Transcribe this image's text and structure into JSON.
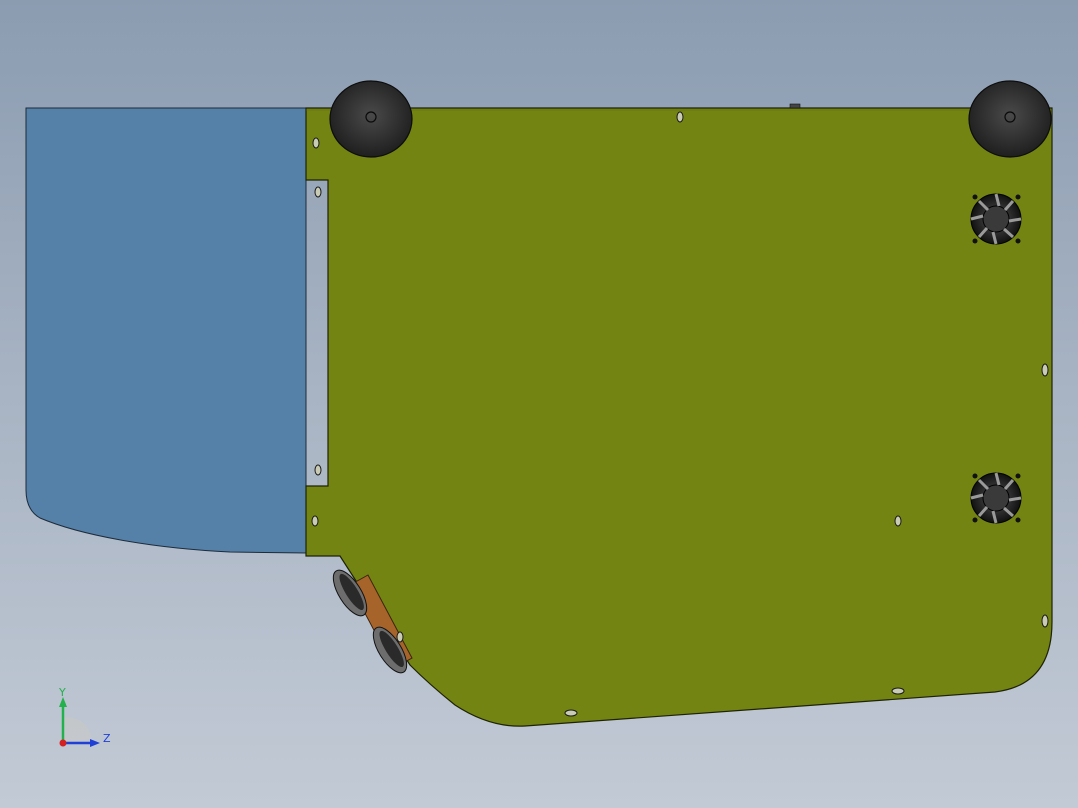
{
  "viewport": {
    "background_top": "#8b9cb1",
    "background_bottom": "#c2cad5"
  },
  "model": {
    "main_panel_color": "#748412",
    "side_cover_color": "#5580a7",
    "wheel_color": "#2d2d2d",
    "bracket_color": "#a6642a",
    "fan_count": 2,
    "wheel_count": 2
  },
  "triad": {
    "y_label": "Y",
    "z_label": "Z",
    "y_color": "#22b14c",
    "z_color": "#1f3fd6",
    "x_color": "#d42020"
  }
}
